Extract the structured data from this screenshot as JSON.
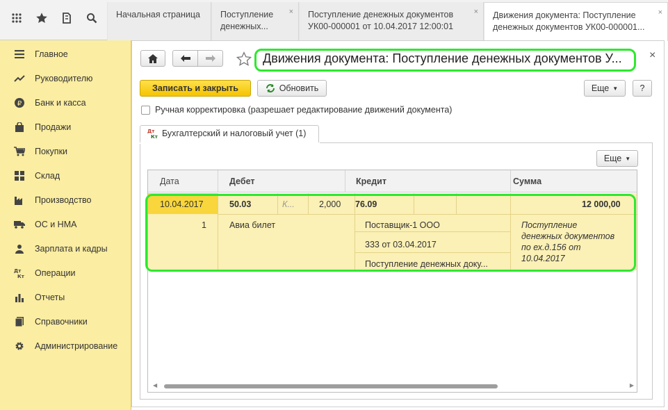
{
  "topbar": {
    "tabs": [
      {
        "label": "Начальная страница"
      },
      {
        "label": "Поступление денежных..."
      },
      {
        "label": "Поступление денежных документов УК00-000001 от 10.04.2017 12:00:01"
      },
      {
        "label": "Движения документа: Поступление денежных документов УК00-000001..."
      }
    ],
    "close_glyph": "×"
  },
  "sidebar": {
    "items": [
      {
        "label": "Главное",
        "icon": "menu-icon"
      },
      {
        "label": "Руководителю",
        "icon": "trend-icon"
      },
      {
        "label": "Банк и касса",
        "icon": "ruble-icon"
      },
      {
        "label": "Продажи",
        "icon": "bag-icon"
      },
      {
        "label": "Покупки",
        "icon": "cart-icon"
      },
      {
        "label": "Склад",
        "icon": "warehouse-icon"
      },
      {
        "label": "Производство",
        "icon": "factory-icon"
      },
      {
        "label": "ОС и НМА",
        "icon": "truck-icon"
      },
      {
        "label": "Зарплата и кадры",
        "icon": "people-icon"
      },
      {
        "label": "Операции",
        "icon": "dt-kt-icon"
      },
      {
        "label": "Отчеты",
        "icon": "bar-chart-icon"
      },
      {
        "label": "Справочники",
        "icon": "book-icon"
      },
      {
        "label": "Администрирование",
        "icon": "gear-icon"
      }
    ]
  },
  "window": {
    "title": "Движения документа: Поступление денежных документов У...",
    "close_glyph": "×",
    "toolbar": {
      "save_close": "Записать и закрыть",
      "refresh": "Обновить",
      "more": "Еще",
      "help": "?"
    },
    "manual_checkbox": "Ручная корректировка (разрешает редактирование движений документа)",
    "subtab": "Бухгалтерский и налоговый учет (1)",
    "table_more": "Еще",
    "columns": {
      "date": "Дата",
      "debit": "Дебет",
      "credit": "Кредит",
      "sum": "Сумма"
    },
    "row": {
      "date": "10.04.2017",
      "debit_account": "50.03",
      "debit_k": "К...",
      "debit_qty": "2,000",
      "credit_account": "76.09",
      "sum": "12 000,00",
      "num": "1",
      "debit_subconto": "Авиа билет",
      "credit_sub1": "Поставщик-1 ООО",
      "credit_sub2": "333 от 03.04.2017",
      "credit_sub3": "Поступление денежных доку...",
      "content_line1": "Поступление",
      "content_line2": "денежных документов",
      "content_line3": "по ех.д.156 от",
      "content_line4": "10.04.2017"
    }
  },
  "colors": {
    "sidebar_bg": "#fbeda1",
    "accent_button": "#f5c400",
    "row_highlight": "#fbf0b5",
    "annotation_green": "#2ee82e"
  }
}
